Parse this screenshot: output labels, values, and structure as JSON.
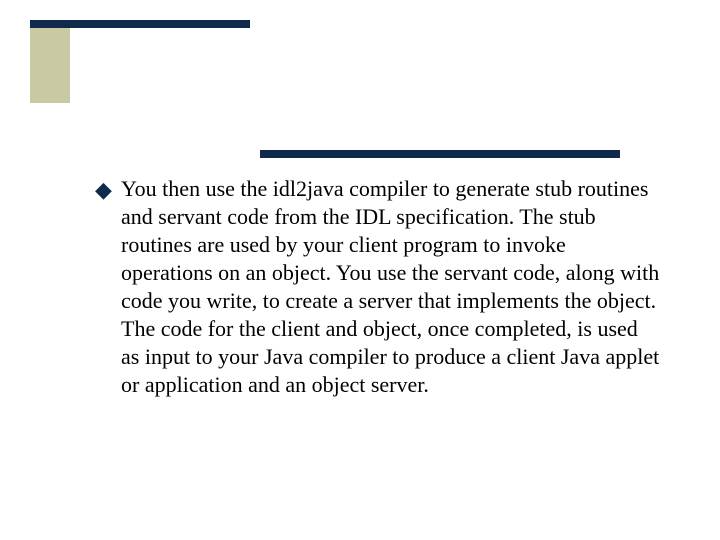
{
  "bullets": [
    {
      "marker": "◆",
      "text": "You then use the idl2java compiler to generate stub routines and servant code from the IDL specification. The stub routines are used by your client program to invoke operations on an object. You use the servant code, along with code you write, to create a server that implements the object. The code for the client and object, once completed, is used as input to your Java compiler to produce a client Java applet or application and an object server."
    }
  ]
}
